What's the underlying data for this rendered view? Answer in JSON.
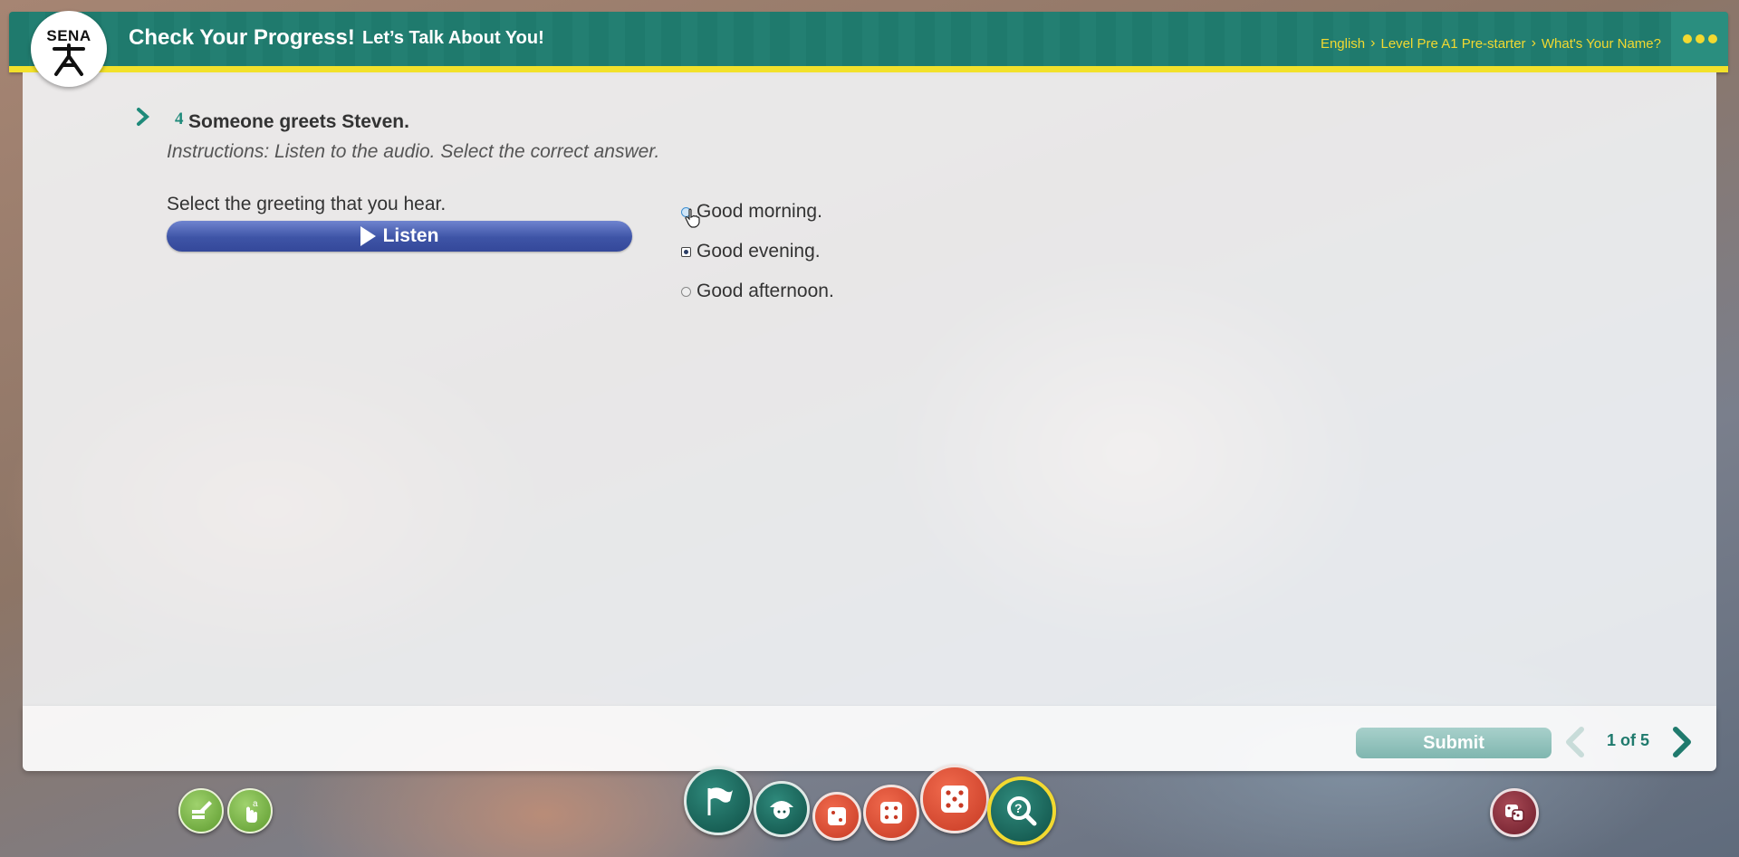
{
  "header": {
    "logo_text": "SENA",
    "title": "Check Your Progress!",
    "subtitle": "Let’s Talk About You!",
    "breadcrumb": [
      "English",
      "Level Pre A1 Pre-starter",
      "What's Your Name?"
    ],
    "colors": {
      "bar": "#1f7a6d",
      "accent": "#f2e12a"
    }
  },
  "question": {
    "number": "4",
    "title": "Someone greets Steven.",
    "instructions": "Instructions: Listen to the audio. Select the correct answer.",
    "prompt": "Select the greeting that you hear.",
    "listen_label": "Listen",
    "options": [
      {
        "label": "Good morning.",
        "state": "hover"
      },
      {
        "label": "Good evening.",
        "state": "checked"
      },
      {
        "label": "Good afternoon.",
        "state": "unchecked"
      }
    ]
  },
  "footer": {
    "submit_label": "Submit",
    "page_indicator": "1 of 5"
  },
  "bottom_nav": {
    "left_tools": [
      "edit-tool-icon",
      "touch-tool-icon"
    ],
    "center": [
      "flag-icon",
      "student-icon",
      "dice-two-icon",
      "dice-four-icon",
      "dice-five-icon",
      "search-help-icon"
    ],
    "right": [
      "dice-box-icon"
    ]
  }
}
